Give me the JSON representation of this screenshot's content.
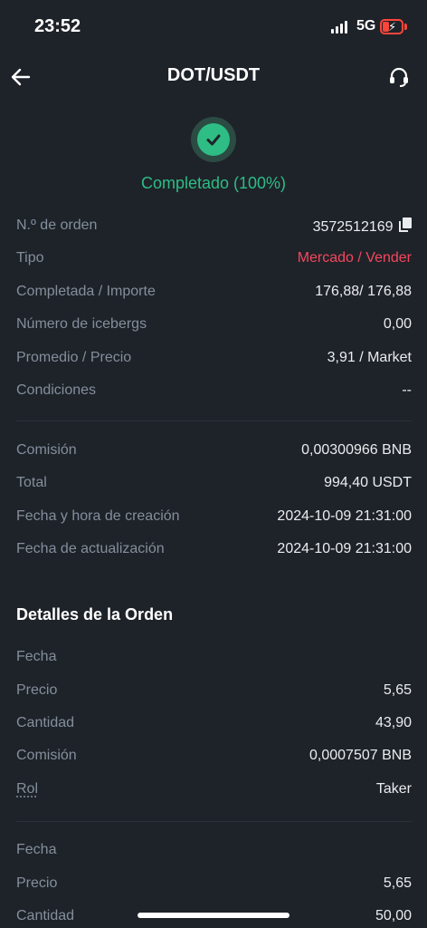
{
  "status_bar": {
    "time": "23:52",
    "network": "5G"
  },
  "header": {
    "title": "DOT/USDT"
  },
  "status": {
    "label": "Completado (100%)"
  },
  "order_info": [
    {
      "label": "N.º de orden",
      "value": "3572512169"
    },
    {
      "label": "Tipo",
      "value": "Mercado / Vender"
    },
    {
      "label": "Completada / Importe",
      "value": "176,88/ 176,88"
    },
    {
      "label": "Número de icebergs",
      "value": "0,00"
    },
    {
      "label": "Promedio / Precio",
      "value": "3,91 / Market"
    },
    {
      "label": "Condiciones",
      "value": "--"
    }
  ],
  "fees": [
    {
      "label": "Comisión",
      "value": "0,00300966 BNB"
    },
    {
      "label": "Total",
      "value": "994,40 USDT"
    },
    {
      "label": "Fecha y hora de creación",
      "value": "2024-10-09  21:31:00"
    },
    {
      "label": "Fecha de actualización",
      "value": "2024-10-09  21:31:00"
    }
  ],
  "details": {
    "title": "Detalles de la Orden",
    "fills": [
      {
        "date_label": "Fecha",
        "date_value": "",
        "price_label": "Precio",
        "price_value": "5,65",
        "qty_label": "Cantidad",
        "qty_value": "43,90",
        "fee_label": "Comisión",
        "fee_value": "0,0007507 BNB",
        "role_label": "Rol",
        "role_value": "Taker"
      },
      {
        "date_label": "Fecha",
        "date_value": "",
        "price_label": "Precio",
        "price_value": "5,65",
        "qty_label": "Cantidad",
        "qty_value": "50,00"
      }
    ]
  },
  "colors": {
    "background": "#1e2329",
    "success": "#2ebd85",
    "sell": "#f6465d",
    "label": "#848e9c"
  }
}
